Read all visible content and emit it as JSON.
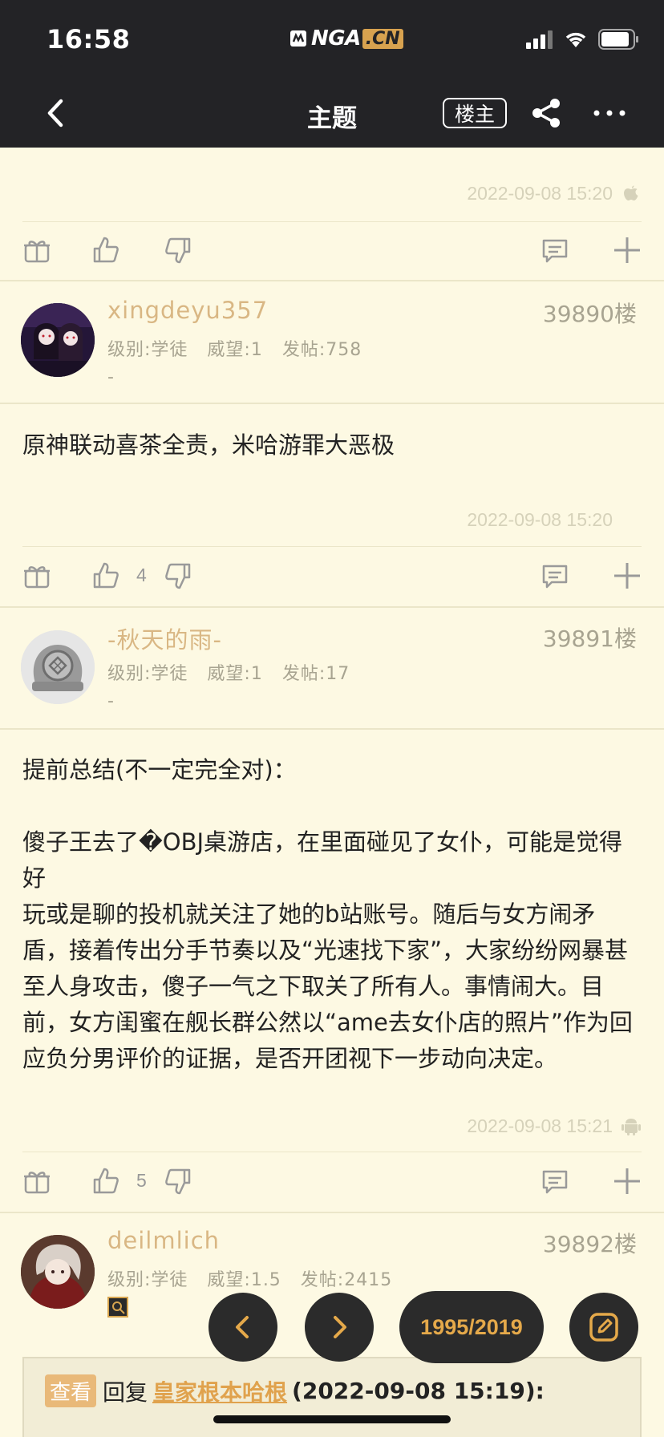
{
  "status_bar": {
    "time": "16:58",
    "logo_text": "NGA",
    "logo_suffix": ".CN"
  },
  "nav": {
    "title": "主题",
    "louzhu_label": "楼主"
  },
  "prev_post": {
    "timestamp": "2022-09-08 15:20",
    "platform_icon": "apple-icon"
  },
  "posts": [
    {
      "username": "xingdeyu357",
      "level": "级别:学徒",
      "prestige": "威望:1",
      "post_count": "发帖:758",
      "signature": "-",
      "floor": "39890楼",
      "content": "原神联动喜茶全责，米哈游罪大恶极",
      "timestamp": "2022-09-08 15:20",
      "likes": "4"
    },
    {
      "username": "-秋天的雨-",
      "level": "级别:学徒",
      "prestige": "威望:1",
      "post_count": "发帖:17",
      "signature": "-",
      "floor": "39891楼",
      "content_lines": [
        "提前总结(不一定完全对)：",
        "",
        "傻子王去了�OBJ桌游店，在里面碰见了女仆，可能是觉得好",
        "玩或是聊的投机就关注了她的b站账号。随后与女方闹矛",
        "盾，接着传出分手节奏以及“光速找下家”，大家纷纷网暴甚",
        "至人身攻击，傻子一气之下取关了所有人。事情闹大。目",
        "前，女方闺蜜在舰长群公然以“ame去女仆店的照片”作为回",
        "应负分男评价的证据，是否开团视下一步动向决定。"
      ],
      "timestamp": "2022-09-08 15:21",
      "platform_icon": "android-icon",
      "likes": "5"
    },
    {
      "username": "deilmlich",
      "level": "级别:学徒",
      "prestige": "威望:1.5",
      "post_count": "发帖:2415",
      "floor": "39892楼"
    }
  ],
  "pager": {
    "page": "1995/2019"
  },
  "quote": {
    "view_label": "查看",
    "reply_word": "回复",
    "quoted_user": "皇家根本哈根",
    "quoted_date": "(2022-09-08 15:19):"
  },
  "colors": {
    "bg": "#fdf9e3",
    "topbar": "#232326",
    "accent": "#e5a94a",
    "username": "#d9b784"
  }
}
